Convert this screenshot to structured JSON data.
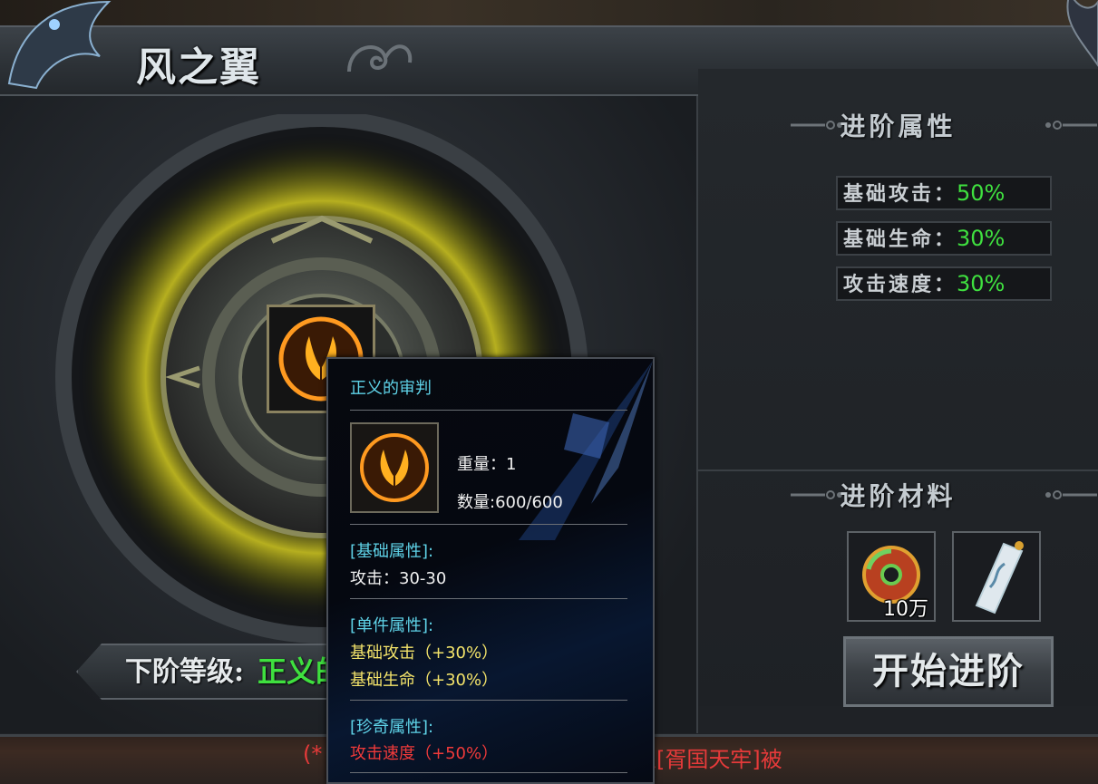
{
  "window": {
    "title": "风之翼"
  },
  "advance_attributes": {
    "heading": "进阶属性",
    "stats": [
      {
        "label": "基础攻击：",
        "value": "50%"
      },
      {
        "label": "基础生命：",
        "value": "30%"
      },
      {
        "label": "攻击速度：",
        "value": "30%"
      }
    ]
  },
  "materials": {
    "heading": "进阶材料",
    "items": [
      {
        "icon": "jade-disc-icon",
        "quantity": "10万"
      },
      {
        "icon": "scroll-icon",
        "quantity": ""
      }
    ]
  },
  "start_button": {
    "label": "开始进阶"
  },
  "next_level": {
    "label": "下阶等级:",
    "value": "正义的审判"
  },
  "chat": {
    "text_left": "(*",
    "text_right": "王[胥国天牢]被"
  },
  "tooltip": {
    "title": "正义的审判",
    "weight": "重量：1",
    "count": "数量:600/600",
    "basic_header": "[基础属性]:",
    "basic_attack": "攻击：30-30",
    "piece_header": "[单件属性]:",
    "piece_lines": [
      "基础攻击（+30%）",
      "基础生命（+30%）"
    ],
    "rare_header": "[珍奇属性]:",
    "rare_lines": [
      "攻击速度（+50%）"
    ]
  },
  "colors": {
    "stat_value": "#3fe03f",
    "tooltip_header": "#5fd3e8",
    "tooltip_piece": "#f3e36a",
    "tooltip_rare": "#f03a3a"
  }
}
